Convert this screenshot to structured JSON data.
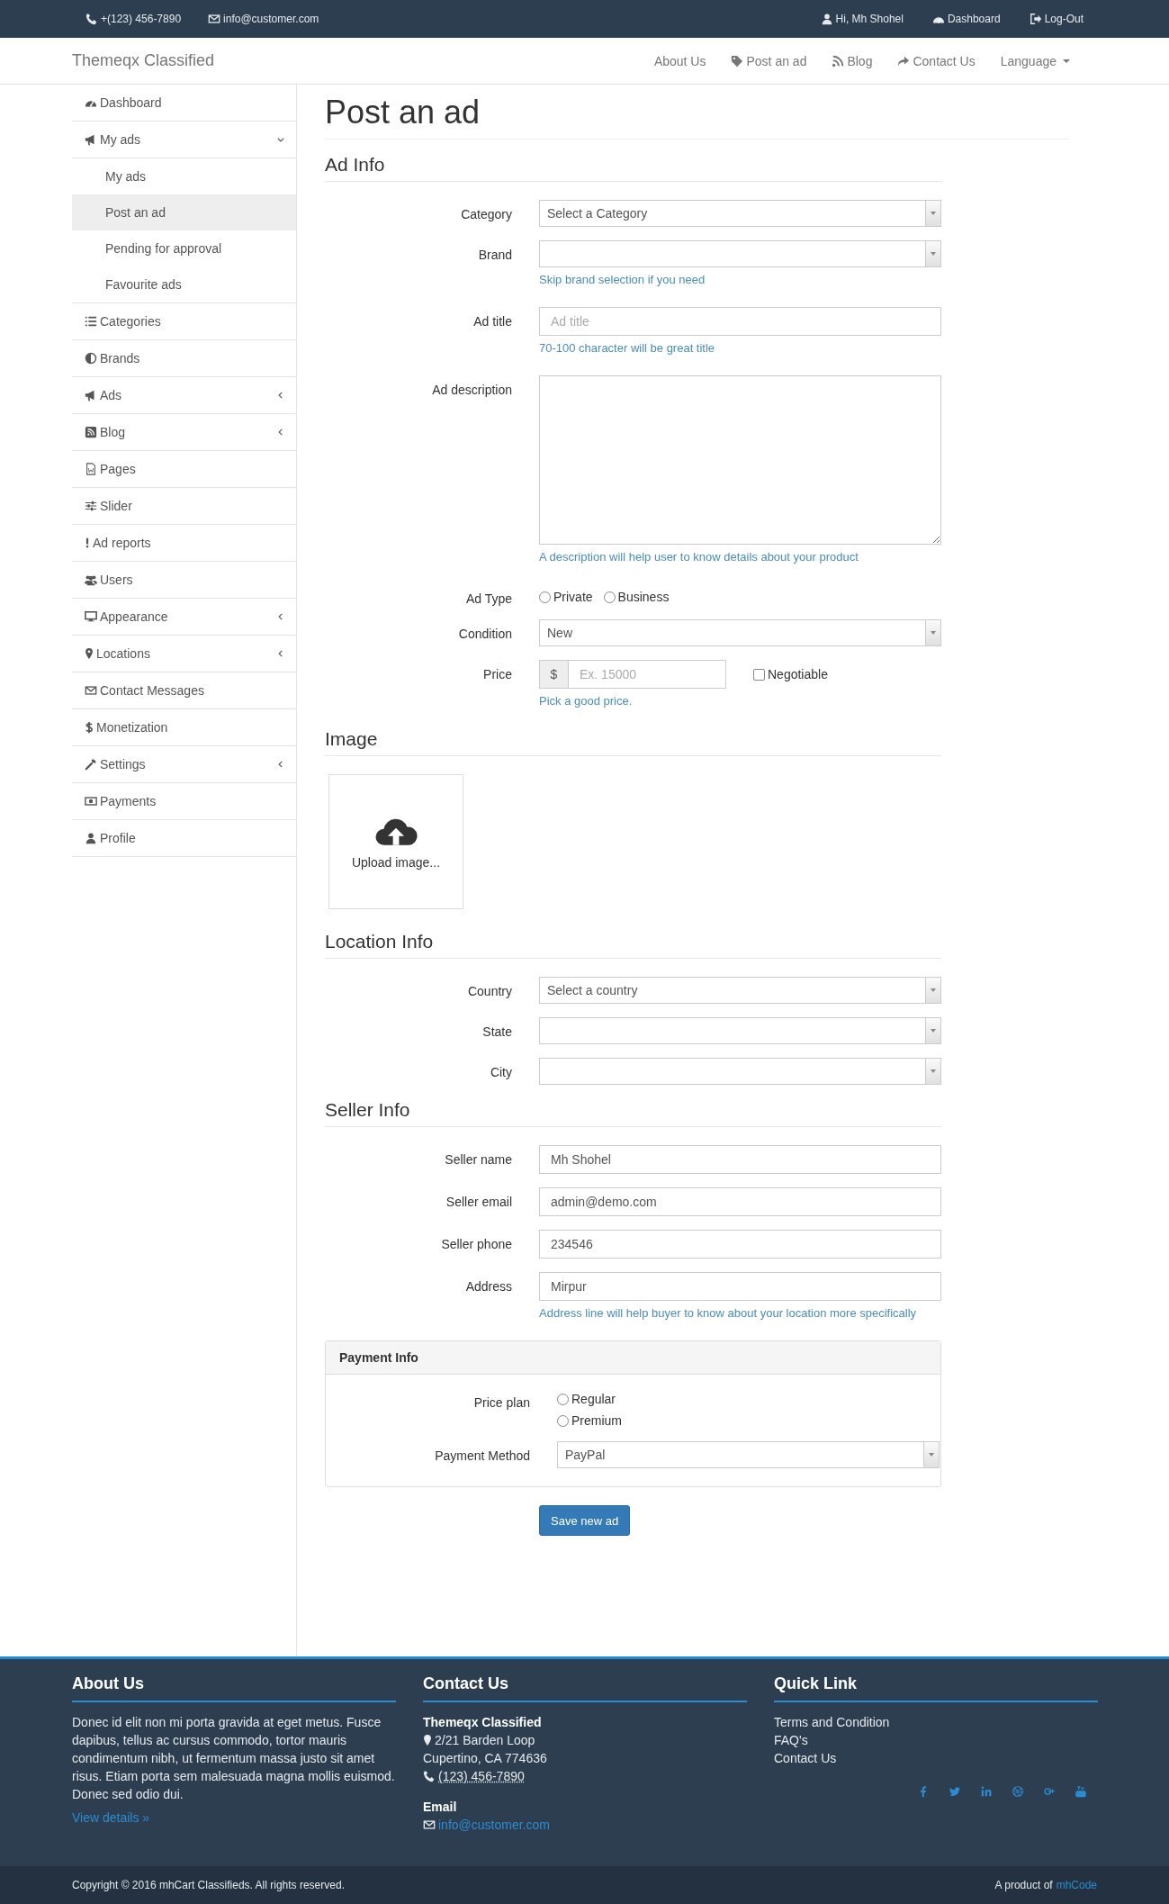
{
  "top_bar": {
    "contacts": [
      "+(123) 456-7890",
      "info@customer.com"
    ],
    "user_links": [
      "Hi, Mh Shohel",
      "Dashboard",
      "Log-Out"
    ]
  },
  "navbar": {
    "brand": "Themeqx Classified",
    "links": [
      {
        "label": "About Us",
        "kind": "link"
      },
      {
        "label": "Post an ad",
        "kind": "link"
      },
      {
        "label": "Blog",
        "kind": "link"
      },
      {
        "label": "Contact Us",
        "kind": "link"
      },
      {
        "label": "Language",
        "kind": "dropdown"
      }
    ]
  },
  "sidebar": {
    "items": [
      {
        "label": "Dashboard",
        "kind": "link"
      },
      {
        "label": "My ads",
        "kind": "group",
        "expanded": true,
        "children": [
          {
            "label": "My ads",
            "selected": false
          },
          {
            "label": "Post an ad",
            "selected": true
          },
          {
            "label": "Pending for approval",
            "selected": false
          },
          {
            "label": "Favourite ads",
            "selected": false
          }
        ]
      },
      {
        "label": "Categories",
        "kind": "link"
      },
      {
        "label": "Brands",
        "kind": "link"
      },
      {
        "label": "Ads",
        "kind": "group",
        "expanded": false
      },
      {
        "label": "Blog",
        "kind": "group",
        "expanded": false
      },
      {
        "label": "Pages",
        "kind": "link"
      },
      {
        "label": "Slider",
        "kind": "link"
      },
      {
        "label": "Ad reports",
        "kind": "link"
      },
      {
        "label": "Users",
        "kind": "link"
      },
      {
        "label": "Appearance",
        "kind": "group",
        "expanded": false
      },
      {
        "label": "Locations",
        "kind": "group",
        "expanded": false
      },
      {
        "label": "Contact Messages",
        "kind": "link"
      },
      {
        "label": "Monetization",
        "kind": "link"
      },
      {
        "label": "Settings",
        "kind": "group",
        "expanded": false
      },
      {
        "label": "Payments",
        "kind": "link"
      },
      {
        "label": "Profile",
        "kind": "link"
      }
    ]
  },
  "page_title": "Post an ad",
  "sections": [
    {
      "title": "Ad Info",
      "kind": "form",
      "fields": [
        {
          "kind": "select",
          "label": "Category",
          "value": "Select a Category"
        },
        {
          "kind": "select",
          "label": "Brand",
          "help": "Skip brand selection if you need"
        },
        {
          "kind": "text",
          "label": "Ad title",
          "placeholder": "Ad title",
          "help": "70-100 character will be great title"
        },
        {
          "kind": "textarea",
          "label": "Ad description",
          "help": "A description will help user to know details about your product"
        },
        {
          "kind": "radio",
          "label": "Ad Type",
          "options": [
            {
              "label": "Private",
              "selected": false
            },
            {
              "label": "Business",
              "selected": false
            }
          ]
        },
        {
          "kind": "select",
          "label": "Condition",
          "value": "New"
        },
        {
          "kind": "price",
          "label": "Price",
          "prefix": "$",
          "placeholder": "Ex. 15000",
          "checkbox": {
            "label": "Negotiable",
            "checked": false
          },
          "help": "Pick a good price."
        }
      ]
    },
    {
      "title": "Image",
      "kind": "upload",
      "upload_label": "Upload image..."
    },
    {
      "title": "Location Info",
      "kind": "form",
      "fields": [
        {
          "kind": "select",
          "label": "Country",
          "value": "Select a country"
        },
        {
          "kind": "select",
          "label": "State"
        },
        {
          "kind": "select",
          "label": "City"
        }
      ]
    },
    {
      "title": "Seller Info",
      "kind": "form",
      "fields": [
        {
          "kind": "text",
          "label": "Seller name",
          "value": "Mh Shohel"
        },
        {
          "kind": "text",
          "label": "Seller email",
          "value": "admin@demo.com"
        },
        {
          "kind": "text",
          "label": "Seller phone",
          "value": "234546"
        },
        {
          "kind": "text",
          "label": "Address",
          "value": "Mirpur",
          "help": "Address line will help buyer to know about your location more specifically"
        }
      ]
    }
  ],
  "payment_panel": {
    "title": "Payment Info",
    "fields": [
      {
        "kind": "radio_stack",
        "label": "Price plan",
        "options": [
          {
            "label": "Regular",
            "selected": false
          },
          {
            "label": "Premium",
            "selected": false
          }
        ]
      },
      {
        "kind": "select",
        "label": "Payment Method",
        "value": "PayPal"
      }
    ]
  },
  "save_button": "Save new ad",
  "footer": {
    "about": {
      "title": "About Us",
      "text": "Donec id elit non mi porta gravida at eget metus. Fusce dapibus, tellus ac cursus commodo, tortor mauris condimentum nibh, ut fermentum massa justo sit amet risus. Etiam porta sem malesuada magna mollis euismod. Donec sed odio dui.",
      "link": "View details »"
    },
    "contact": {
      "title": "Contact Us",
      "company": "Themeqx Classified",
      "address": [
        "2/21 Barden Loop",
        "Cupertino, CA 774636"
      ],
      "phone": "(123) 456-7890",
      "email_title": "Email",
      "email": "info@customer.com"
    },
    "quick_links": {
      "title": "Quick Link",
      "links": [
        "Terms and Condition",
        "FAQ's",
        "Contact Us"
      ]
    },
    "copyright": "Copyright © 2016 mhCart Classifieds. All rights reserved.",
    "credit": "A product of",
    "credit_link": "mhCode"
  }
}
